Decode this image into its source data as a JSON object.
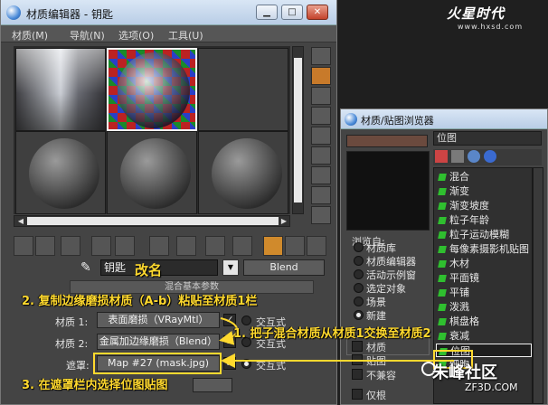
{
  "material_editor": {
    "title": "材质编辑器 - 钥匙",
    "menus": [
      "材质(M)",
      "导航(N)",
      "选项(O)",
      "工具(U)"
    ],
    "window_buttons": [
      "▁",
      "□",
      "✕"
    ],
    "material_name": "钥匙",
    "material_type": "Blend",
    "rollout_title": "混合基本参数",
    "params": {
      "mat1_label": "材质 1:",
      "mat1_value": "表面磨损（VRayMtl）",
      "mat2_label": "材质 2:",
      "mat2_value": "金属加边缘磨损（Blend）",
      "mask_label": "遮罩:",
      "mask_value": "Map #27 (mask.jpg)",
      "interactive_label": "交互式",
      "interactive_label_2": "交互式",
      "interactive_label_3": "交互式"
    },
    "checkmark": "✓"
  },
  "browser": {
    "title": "材质/贴图浏览器",
    "search_value": "位图",
    "browse_from_title": "浏览自:",
    "browse_from": [
      "材质库",
      "材质编辑器",
      "活动示例窗",
      "选定对象",
      "场景",
      "新建"
    ],
    "browse_from_selected": 5,
    "show_group": [
      "材质",
      "贴图"
    ],
    "incompatible_label": "不兼容",
    "root_label": "仅根",
    "map_list": [
      "混合",
      "渐变",
      "渐变坡度",
      "粒子年龄",
      "粒子运动模糊",
      "每像素摄影机贴图",
      "木材",
      "平面镜",
      "平铺",
      "泼溅",
      "棋盘格",
      "衰减",
      "位图",
      "细胞"
    ],
    "selected_map": "位图"
  },
  "annotations": {
    "rename": "改名",
    "step2": "2. 复制边缘磨损材质（A-b）粘贴至材质1栏",
    "step1": "1. 把子混合材质从材质1交换至材质2",
    "step3": "3. 在遮罩栏内选择位图贴图"
  },
  "branding": {
    "logo_text": "火星时代",
    "logo_url": "www.hxsd.com",
    "watermark_text": "朱峰社区",
    "watermark_url": "ZF3D.COM"
  },
  "colors": {
    "annotation": "#ffd92e",
    "active_tool": "#d08a2c",
    "map_icon": "#2fbf2f"
  }
}
